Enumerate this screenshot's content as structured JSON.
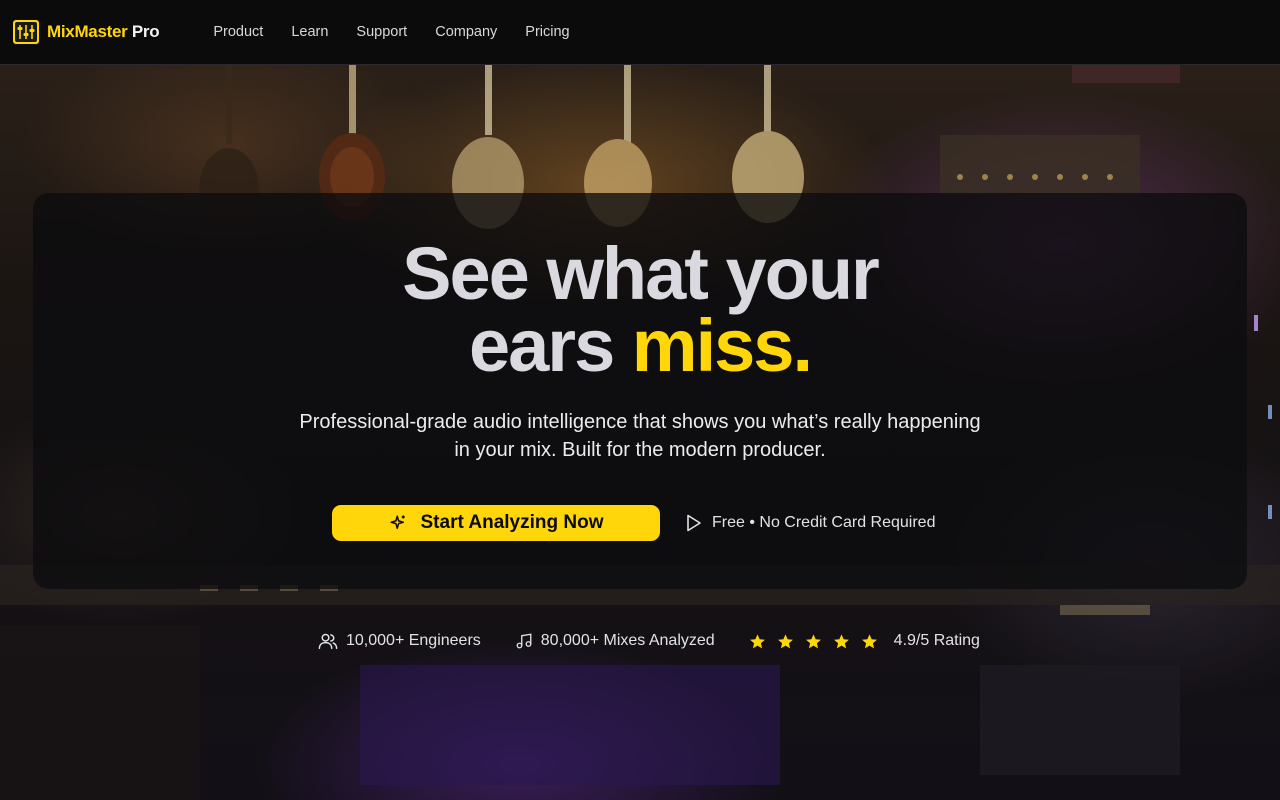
{
  "brand": {
    "name_part1": "MixMaster",
    "name_part2": "Pro",
    "icon": "mixer-faders-icon"
  },
  "nav": {
    "items": [
      {
        "label": "Product"
      },
      {
        "label": "Learn"
      },
      {
        "label": "Support"
      },
      {
        "label": "Company"
      },
      {
        "label": "Pricing"
      }
    ]
  },
  "hero": {
    "headline_line1": "See what your",
    "headline_line2_start": "ears ",
    "headline_accent": "miss.",
    "subtext_line1": "Professional-grade audio intelligence that shows you what’s really happening",
    "subtext_line2": "in your mix. Built for the modern producer.",
    "cta_label": "Start Analyzing Now",
    "cta_icon": "sparkle-icon",
    "note": "Free • No Credit Card Required",
    "note_icon": "play-icon"
  },
  "stats": [
    {
      "icon": "users-icon",
      "label": "10,000+ Engineers"
    },
    {
      "icon": "music-note-icon",
      "label": "80,000+ Mixes Analyzed"
    },
    {
      "icon": "star-icon",
      "label": "4.9/5 Rating",
      "stars": 5
    }
  ],
  "colors": {
    "accent": "#ffd60a",
    "background": "#0b0b0c",
    "text": "#e6e6ea",
    "headline": "#d9d9df"
  }
}
